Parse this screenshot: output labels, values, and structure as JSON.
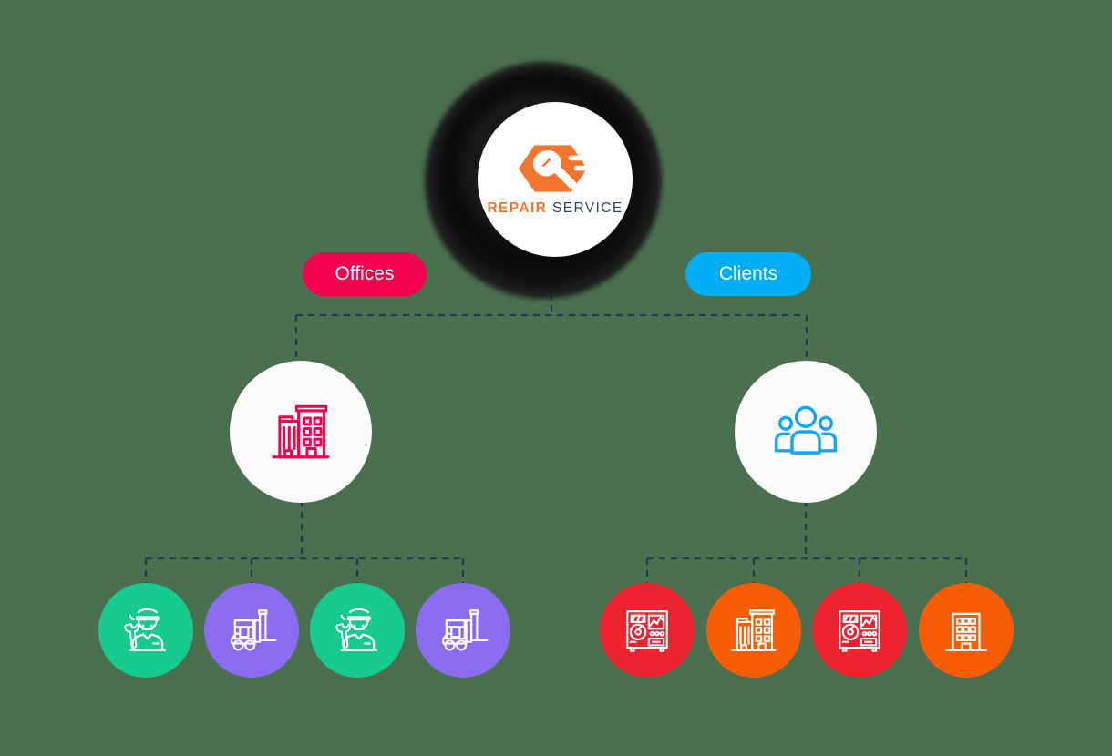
{
  "diagram": {
    "title": "Repair Service organizational tree",
    "background_color": "#4a7050",
    "wire_color": "#223b4d"
  },
  "logo": {
    "name": "repair-service-logo",
    "word_1": "REPAIR",
    "word_2": "SERVICE",
    "word_1_color": "#f4762e",
    "word_2_color": "#33475b",
    "mark_icon": "hexagon-wrench-icon",
    "disc_color": "#ffffff",
    "ring_color": "#161616"
  },
  "branches": [
    {
      "label": "Offices",
      "pill_color": "#f5004f",
      "node_icon": "office-buildings-icon",
      "node_icon_color": "#f5004f",
      "node_background": "#fbfbfc"
    },
    {
      "label": "Clients",
      "pill_color": "#00aef5",
      "node_icon": "people-group-icon",
      "node_icon_color": "#17a7f0",
      "node_background": "#fbfbfc"
    }
  ],
  "leaves": {
    "offices": [
      {
        "icon": "technician-wrench-icon",
        "color": "#17ca90"
      },
      {
        "icon": "forklift-icon",
        "color": "#8b6bf0"
      },
      {
        "icon": "technician-wrench-icon",
        "color": "#17ca90"
      },
      {
        "icon": "forklift-icon",
        "color": "#8b6bf0"
      }
    ],
    "clients": [
      {
        "icon": "industrial-machine-icon",
        "color": "#ed2330"
      },
      {
        "icon": "office-buildings-icon",
        "color": "#f85c05"
      },
      {
        "icon": "industrial-machine-icon",
        "color": "#ed2330"
      },
      {
        "icon": "apartment-building-icon",
        "color": "#f85c05"
      }
    ]
  }
}
